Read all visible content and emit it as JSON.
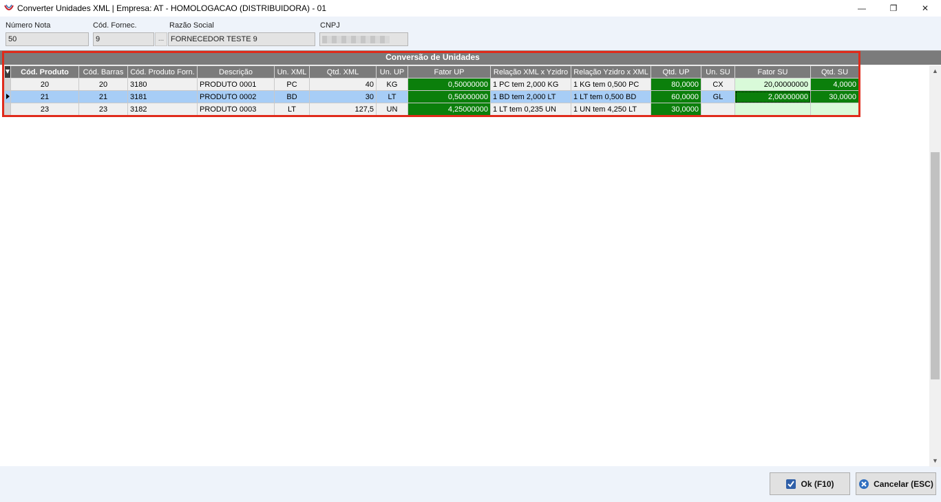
{
  "window": {
    "title": "Converter Unidades XML | Empresa: AT - HOMOLOGACAO (DISTRIBUIDORA) - 01",
    "minimize_glyph": "—",
    "restore_glyph": "❐",
    "close_glyph": "✕"
  },
  "header": {
    "numero_nota_label": "Número Nota",
    "numero_nota_value": "50",
    "cod_fornec_label": "Cód. Fornec.",
    "cod_fornec_value": "9",
    "ellipsis_label": "...",
    "razao_social_label": "Razão Social",
    "razao_social_value": "FORNECEDOR TESTE 9",
    "cnpj_label": "CNPJ"
  },
  "grid": {
    "caption": "Conversão de Unidades",
    "columns": [
      "Cód. Produto",
      "Cód. Barras",
      "Cód. Produto Forn.",
      "Descrição",
      "Un. XML",
      "Qtd. XML",
      "Un. UP",
      "Fator UP",
      "Relação XML x Yzidro",
      "Relação Yzidro x XML",
      "Qtd. UP",
      "Un. SU",
      "Fator SU",
      "Qtd. SU"
    ],
    "rows": [
      [
        "20",
        "20",
        "3180",
        "PRODUTO 0001",
        "PC",
        "40",
        "KG",
        "0,50000000",
        "1 PC tem 2,000 KG",
        "1 KG tem 0,500 PC",
        "80,0000",
        "CX",
        "20,00000000",
        "4,0000"
      ],
      [
        "21",
        "21",
        "3181",
        "PRODUTO 0002",
        "BD",
        "30",
        "LT",
        "0,50000000",
        "1 BD tem 2,000 LT",
        "1 LT tem 0,500 BD",
        "60,0000",
        "GL",
        "2,00000000",
        "30,0000"
      ],
      [
        "23",
        "23",
        "3182",
        "PRODUTO 0003",
        "LT",
        "127,5",
        "UN",
        "4,25000000",
        "1 LT tem 0,235 UN",
        "1 UN tem 4,250 LT",
        "30,0000",
        "",
        "",
        ""
      ]
    ]
  },
  "buttons": {
    "ok_label": "Ok (F10)",
    "cancel_label": "Cancelar (ESC)"
  },
  "colors": {
    "accent_green": "#0b7f0b",
    "light_green": "#d9fad9",
    "selected_row": "#a7cdf6",
    "highlight_frame": "#e02a1a",
    "header_gray": "#7b7b7b"
  }
}
